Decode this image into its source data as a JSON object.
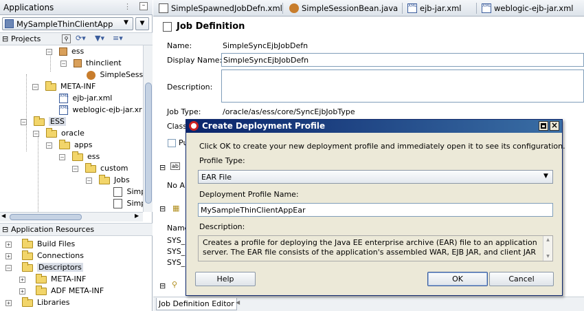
{
  "left_panel": {
    "title": "Applications",
    "app_selector": "MySampleThinClientApp",
    "projects_label": "Projects",
    "tree": [
      {
        "label": "ess"
      },
      {
        "label": "thinclient"
      },
      {
        "label": "SimpleSessi"
      },
      {
        "label": "META-INF"
      },
      {
        "label": "ejb-jar.xml"
      },
      {
        "label": "weblogic-ejb-jar.xr"
      },
      {
        "label": "ESS"
      },
      {
        "label": "oracle"
      },
      {
        "label": "apps"
      },
      {
        "label": "ess"
      },
      {
        "label": "custom"
      },
      {
        "label": "Jobs"
      },
      {
        "label": "Simp"
      },
      {
        "label": "Simp"
      }
    ],
    "resources_title": "Application Resources",
    "resources": [
      {
        "label": "Build Files"
      },
      {
        "label": "Connections"
      },
      {
        "label": "Descriptors"
      },
      {
        "label": "META-INF"
      },
      {
        "label": "ADF META-INF"
      },
      {
        "label": "Libraries"
      }
    ]
  },
  "tabs": [
    {
      "label": "SimpleSpawnedJobDefn.xml"
    },
    {
      "label": "SimpleSessionBean.java"
    },
    {
      "label": "ejb-jar.xml"
    },
    {
      "label": "weblogic-ejb-jar.xml"
    }
  ],
  "editor": {
    "title": "Job Definition",
    "name_label": "Name:",
    "name_value": "SimpleSyncEjbJobDefn",
    "display_name_label": "Display Name:",
    "display_name_value": "SimpleSyncEjbJobDefn",
    "description_label": "Description:",
    "job_type_label": "Job Type:",
    "job_type_value": "/oracle/as/ess/core/SyncEjbJobType",
    "class_label_partial": "Class",
    "pu_partial": "Pu",
    "no_ap_partial": "No Ap",
    "name_col_partial": "Name",
    "sys_rows": [
      "SYS_",
      "SYS_",
      "SYS_"
    ],
    "bottom_tab": "Job Definition Editor"
  },
  "dialog": {
    "title": "Create Deployment Profile",
    "instruction": "Click OK to create your new deployment profile and immediately open it to see its configuration.",
    "profile_type_label": "Profile Type:",
    "profile_type_value": "EAR File",
    "name_label": "Deployment Profile Name:",
    "name_value": "MySampleThinClientAppEar",
    "description_label": "Description:",
    "description_text": "Creates a profile for deploying the Java EE enterprise archive (EAR) file to an application server.  The EAR file consists of the application's assembled WAR, EJB JAR, and client JAR",
    "help_button": "Help",
    "ok_button": "OK",
    "cancel_button": "Cancel"
  },
  "colors": {
    "dialog_title_bg": "#0a246a",
    "panel_header": "#dde3ea",
    "accent": "#3a5c9c"
  }
}
